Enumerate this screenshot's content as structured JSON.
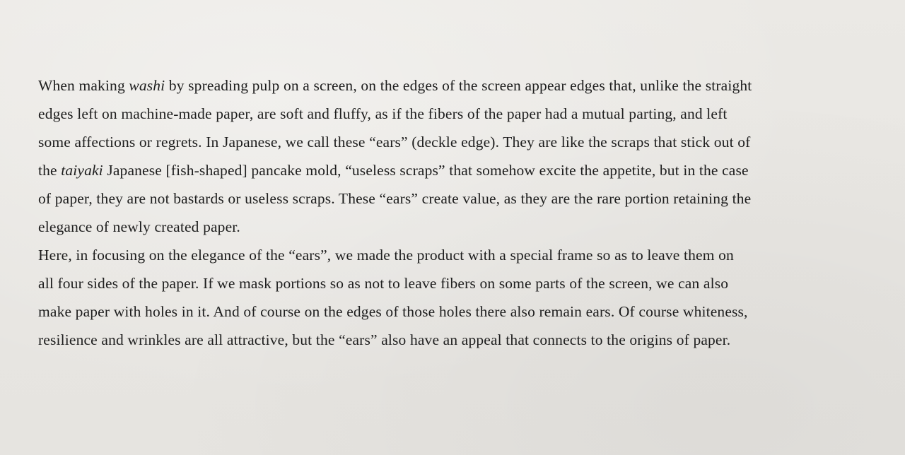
{
  "document": {
    "paragraph_1": {
      "line_1": {
        "pre": "When making ",
        "em": "washi",
        "post": " by spreading pulp on a screen, on the edges of the screen appear edges that, unlike the straight"
      },
      "line_2": "edges left on machine-made paper, are soft and fluffy, as if the fibers of the paper had a mutual parting, and left",
      "line_3": "some affections or regrets. In Japanese, we call these “ears” (deckle edge). They are like the scraps that stick out of",
      "line_4": {
        "pre": "the ",
        "em": "taiyaki",
        "post": " Japanese [fish-shaped] pancake mold, “useless scraps” that somehow excite the appetite, but in the case"
      },
      "line_5": "of paper, they are not bastards or useless scraps. These “ears” create value, as they are the rare portion retaining the",
      "line_6": "elegance of newly created paper."
    },
    "paragraph_2": {
      "line_1": "Here, in focusing on the elegance of the “ears”, we made the product with a special frame so as to leave them on",
      "line_2": "all four sides of the paper. If we mask portions so as not to leave fibers on some parts of the screen, we can also",
      "line_3": "make paper with holes in it. And of course on the edges of  those holes there also remain ears. Of course whiteness,",
      "line_4": "resilience and wrinkles are all attractive, but the “ears” also have an appeal that connects to the origins of paper."
    }
  }
}
